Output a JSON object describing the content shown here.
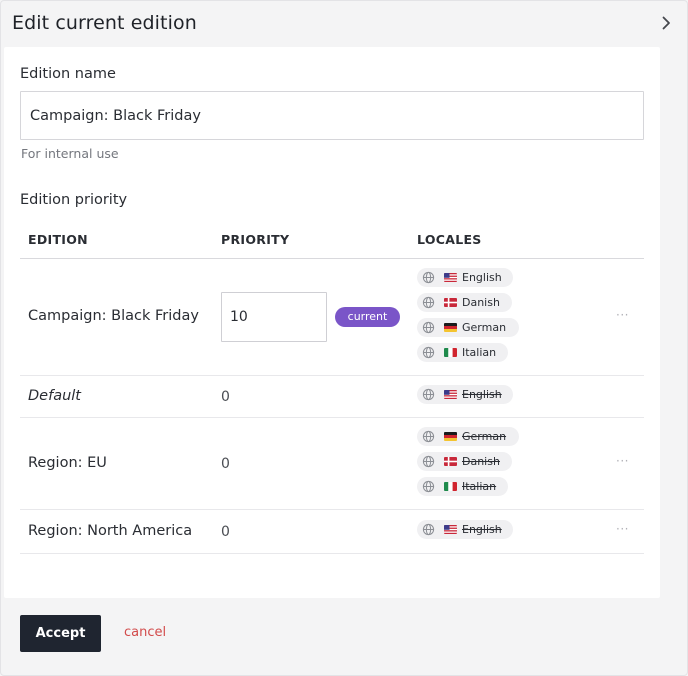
{
  "header": {
    "title": "Edit current edition"
  },
  "form": {
    "name_label": "Edition name",
    "name_value": "Campaign: Black Friday",
    "name_help": "For internal use",
    "priority_label": "Edition priority"
  },
  "table": {
    "columns": [
      "EDITION",
      "PRIORITY",
      "LOCALES"
    ],
    "rows": [
      {
        "edition": "Campaign: Black Friday",
        "priority": "10",
        "badge": "current",
        "locales": [
          "English",
          "Danish",
          "German",
          "Italian"
        ]
      },
      {
        "edition": "Default",
        "priority": "0",
        "locales": [
          "English"
        ]
      },
      {
        "edition": "Region: EU",
        "priority": "0",
        "locales": [
          "German",
          "Danish",
          "Italian"
        ]
      },
      {
        "edition": "Region: North America",
        "priority": "0",
        "locales": [
          "English"
        ]
      }
    ],
    "more_label": "···"
  },
  "actions": {
    "accept_label": "Accept",
    "cancel_label": "cancel"
  },
  "colors": {
    "accent": "#7a55c8",
    "primary_button": "#1f2530",
    "cancel": "#d24b4b"
  },
  "icons": {
    "header": "chevron-right-icon",
    "locale": "globe-icon",
    "flags": [
      "us-flag-icon",
      "dk-flag-icon",
      "de-flag-icon",
      "it-flag-icon"
    ]
  }
}
